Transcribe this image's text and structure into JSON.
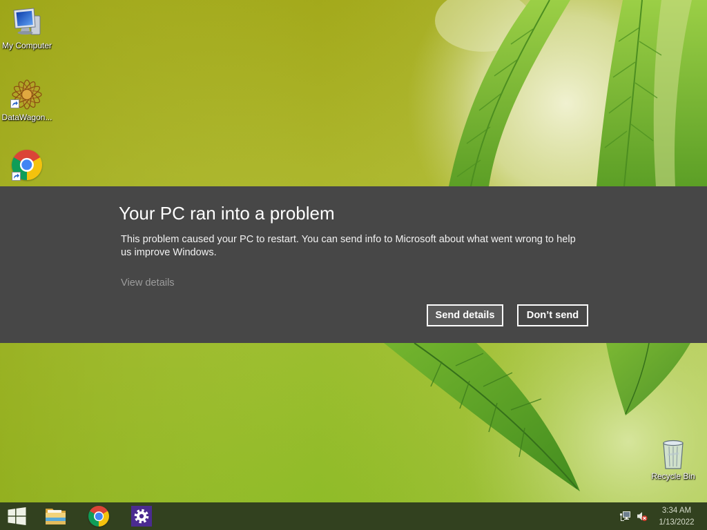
{
  "desktop": {
    "icons": [
      {
        "label": "My Computer",
        "icon": "computer-icon",
        "shortcut": false
      },
      {
        "label": "DataWagon...",
        "icon": "datawagon-icon",
        "shortcut": true
      },
      {
        "icon": "chrome-icon",
        "shortcut": true
      },
      {
        "label": "Recycle Bin",
        "icon": "recycle-bin-icon",
        "shortcut": false
      }
    ]
  },
  "dialog": {
    "title": "Your PC ran into a problem",
    "message": "This problem caused your PC to restart. You can send info to Microsoft about what went wrong to help us improve Windows.",
    "view_details_label": "View details",
    "send_details_label": "Send details",
    "dont_send_label": "Don’t send"
  },
  "taskbar": {
    "start_icon": "windows-logo-icon",
    "pinned_apps": [
      {
        "icon": "file-explorer-icon"
      },
      {
        "icon": "chrome-icon"
      },
      {
        "icon": "settings-gear-icon"
      }
    ],
    "tray_icons": [
      "network-icon",
      "volume-muted-icon"
    ],
    "clock": {
      "time": "3:34 AM",
      "date": "1/13/2022"
    }
  },
  "colors": {
    "banner_background": "#474747",
    "send_button_background": "#5b5b5b",
    "button_border": "#ffffff",
    "link_text": "#9c9c9c",
    "taskbar_background": "#32411f",
    "settings_tile": "#4b2b90"
  }
}
